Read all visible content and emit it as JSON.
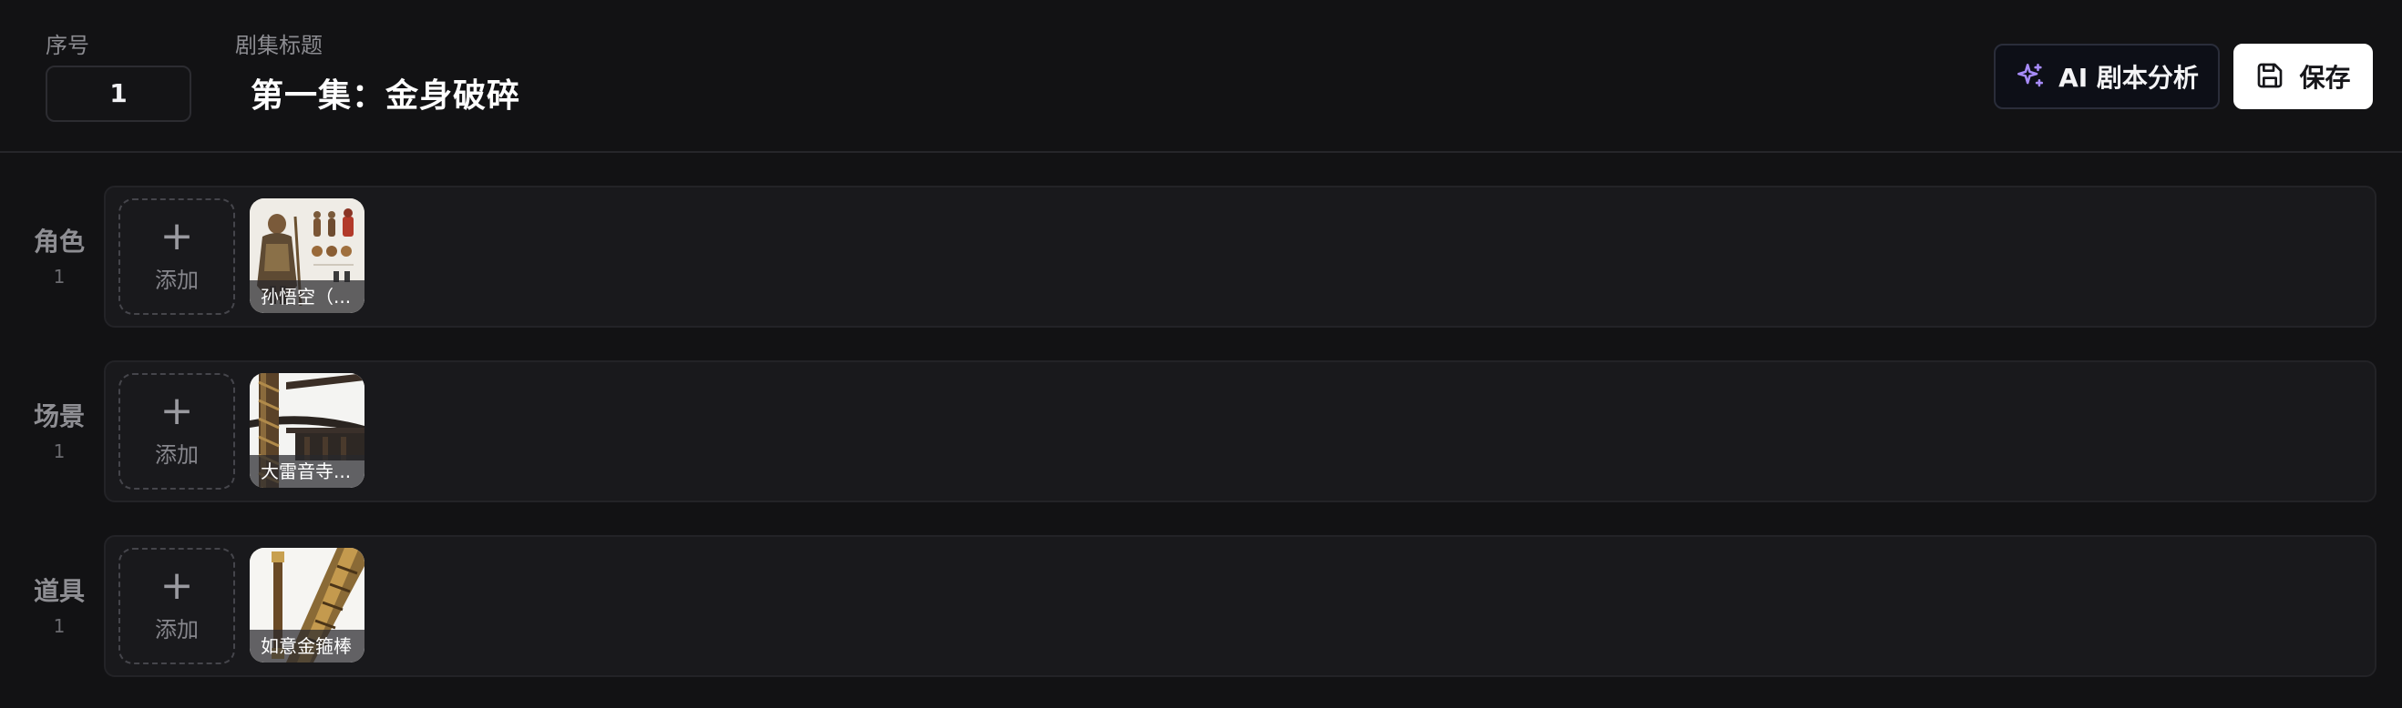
{
  "header": {
    "seq_label": "序号",
    "seq_value": "1",
    "title_label": "剧集标题",
    "episode_title": "第一集：金身破碎",
    "ai_button_label": "AI 剧本分析",
    "save_button_label": "保存",
    "ai_icon": "sparkles-icon",
    "save_icon": "save-icon"
  },
  "rows": [
    {
      "label": "角色",
      "count": "1",
      "add_label": "添加",
      "asset_caption": "孙悟空（..."
    },
    {
      "label": "场景",
      "count": "1",
      "add_label": "添加",
      "asset_caption": "大雷音寺..."
    },
    {
      "label": "道具",
      "count": "1",
      "add_label": "添加",
      "asset_caption": "如意金箍棒"
    }
  ],
  "colors": {
    "background": "#121214",
    "panel": "#19191c",
    "ai_icon_accent": "#a78bfa",
    "save_button_bg": "#ffffff"
  }
}
